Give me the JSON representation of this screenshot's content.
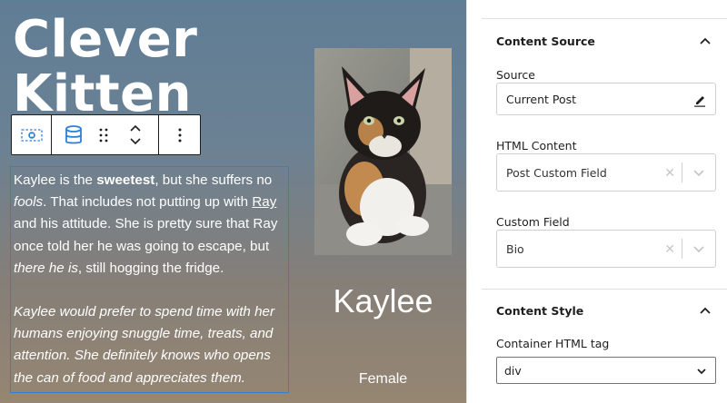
{
  "canvas": {
    "title": "Clever\nKitten",
    "bio": {
      "p1_a": "Kaylee is the ",
      "p1_bold": "sweetest",
      "p1_b": ", but she suffers no ",
      "p1_italic": "fools",
      "p1_c": ". That includes not putting up with ",
      "p1_link": "Ray",
      "p1_d": " and his attitude. She is pretty sure that Ray once told her he was going to escape, but ",
      "p1_italic2": "there he is",
      "p1_e": ", still hogging the fridge.",
      "p2": "Kaylee would prefer to spend time with her humans enjoying snuggle time, treats, and attention. She definitely knows who opens the can of food and appreciates them."
    },
    "name": "Kaylee",
    "gender": "Female"
  },
  "toolbar": {
    "icons": [
      "select-parent-icon",
      "database-icon",
      "drag-handle-icon",
      "move-up-icon",
      "move-down-icon",
      "more-options-icon"
    ]
  },
  "sidebar": {
    "content_source": {
      "title": "Content Source",
      "source_label": "Source",
      "source_value": "Current Post",
      "html_content_label": "HTML Content",
      "html_content_value": "Post Custom Field",
      "custom_field_label": "Custom Field",
      "custom_field_value": "Bio"
    },
    "content_style": {
      "title": "Content Style",
      "container_tag_label": "Container HTML tag",
      "container_tag_value": "div"
    }
  },
  "colors": {
    "accent": "#2f7fd4",
    "text_dark": "#1e1e1e",
    "border": "#cfcfcf"
  }
}
